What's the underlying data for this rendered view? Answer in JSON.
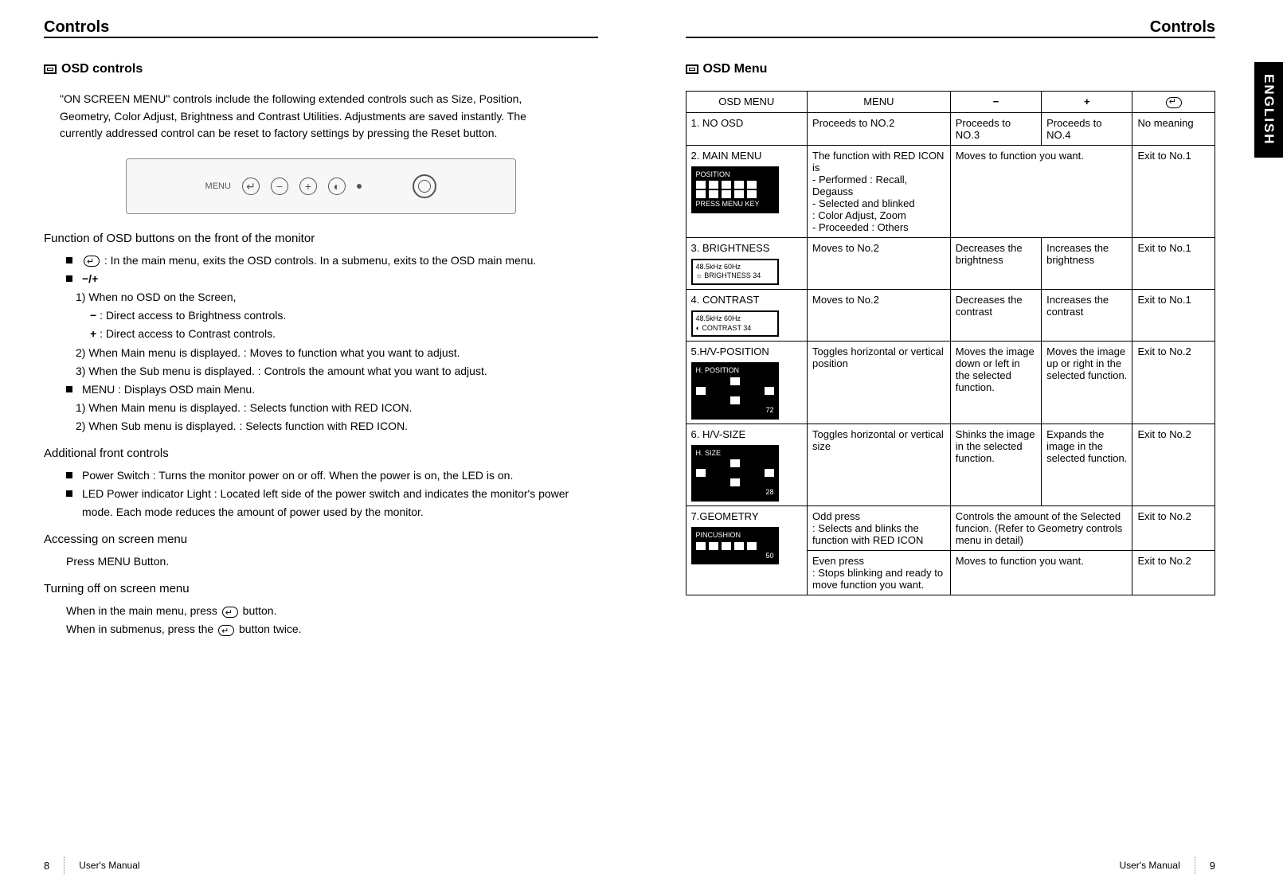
{
  "left": {
    "header": "Controls",
    "section_title": "OSD controls",
    "intro": "\"ON SCREEN MENU\" controls include the following extended controls such as Size,  Position, Geometry, Color Adjust, Brightness and Contrast Utilities.  Adjustments are saved instantly. The currently addressed control can be reset to factory settings by pressing the Reset button.",
    "panel_label": "MENU",
    "sub1_title": "Function of OSD buttons on the front of the monitor",
    "b1": " : In the main menu, exits the OSD controls. In a submenu, exits to the OSD main menu.",
    "b2sym": "−/+",
    "b2_1": "1) When no OSD on the Screen,",
    "b2_1a": " : Direct access to Brightness controls.",
    "b2_1b": " : Direct access to Contrast controls.",
    "b2_2": "2) When Main menu is displayed. : Moves to function what you want to adjust.",
    "b2_3": "3) When the Sub menu is displayed. : Controls the amount what you want to adjust.",
    "b3": "MENU : Displays OSD main Menu.",
    "b3_1": "1) When Main menu is displayed. : Selects function with RED ICON.",
    "b3_2": "2) When Sub menu is displayed. : Selects function with RED ICON.",
    "sub2_title": "Additional front controls",
    "af1": "Power Switch : Turns the monitor power on or off. When the power is on, the LED is on.",
    "af2": "LED Power indicator Light : Located left side of the power switch and indicates the monitor's power mode. Each mode reduces the amount of power used by the monitor.",
    "sub3_title": "Accessing on screen menu",
    "acc1": "Press MENU Button.",
    "sub4_title": "Turning off on screen menu",
    "off1_a": "When in the main menu, press ",
    "off1_b": " button.",
    "off2_a": "When  in submenus, press the ",
    "off2_b": " button twice.",
    "footer_label": "User's Manual",
    "page_num": "8"
  },
  "right": {
    "header": "Controls",
    "section_title": "OSD Menu",
    "lang_tab": "ENGLISH",
    "table": {
      "head": {
        "c1": "OSD MENU",
        "c2": "MENU",
        "c3": "−",
        "c4": "+",
        "c5": "↵"
      },
      "rows": [
        {
          "osd": "1. NO OSD",
          "screen": null,
          "menu": "Proceeds to NO.2",
          "minus": "Proceeds to NO.3",
          "plus": "Proceeds to NO.4",
          "enter": "No meaning"
        },
        {
          "osd": "2. MAIN MENU",
          "screen": {
            "type": "dark",
            "title": "POSITION",
            "foot": "PRESS MENU KEY"
          },
          "menu": "The function with RED ICON is\n- Performed : Recall,\n  Degauss\n- Selected and blinked\n  : Color Adjust, Zoom\n- Proceeded : Others",
          "minus_plus_merged": "Moves to function you want.",
          "enter": "Exit to No.1"
        },
        {
          "osd": "3. BRIGHTNESS",
          "screen": {
            "type": "light",
            "l1": "48.5kHz        60Hz",
            "l2": "☼  BRIGHTNESS  34"
          },
          "menu": "Moves to No.2",
          "minus": "Decreases the brightness",
          "plus": "Increases the brightness",
          "enter": "Exit to No.1"
        },
        {
          "osd": "4. CONTRAST",
          "screen": {
            "type": "light",
            "l1": "48.5kHz        60Hz",
            "l2": "◐   CONTRAST    34"
          },
          "menu": "Moves to No.2",
          "minus": "Decreases the contrast",
          "plus": "Increases the contrast",
          "enter": "Exit to No.1"
        },
        {
          "osd": "5.H/V-POSITION",
          "screen": {
            "type": "dark",
            "title": "H. POSITION",
            "val": "72"
          },
          "menu": "Toggles horizontal or vertical position",
          "minus": "Moves the image down or left in the selected function.",
          "plus": "Moves the image up or right in the selected function.",
          "enter": "Exit to No.2"
        },
        {
          "osd": "6. H/V-SIZE",
          "screen": {
            "type": "dark",
            "title": "H. SIZE",
            "val": "28"
          },
          "menu": "Toggles horizontal or vertical size",
          "minus": "Shinks the image in the selected function.",
          "plus": "Expands the image in the selected function.",
          "enter": "Exit to No.2"
        },
        {
          "osd": "7.GEOMETRY",
          "screen": {
            "type": "dark",
            "title": "PINCUSHION",
            "val": "50"
          },
          "geom_rows": [
            {
              "menu": "Odd press\n: Selects and blinks the function with RED ICON",
              "minus_plus_merged": "Controls the amount of the Selected funcion. (Refer to Geometry controls menu in detail)",
              "enter": "Exit to No.2"
            },
            {
              "menu": "Even press\n: Stops blinking and ready to move function you want.",
              "minus_plus_merged": "Moves to function you want.",
              "enter": "Exit to No.2"
            }
          ]
        }
      ]
    },
    "footer_label": "User's Manual",
    "page_num": "9"
  }
}
